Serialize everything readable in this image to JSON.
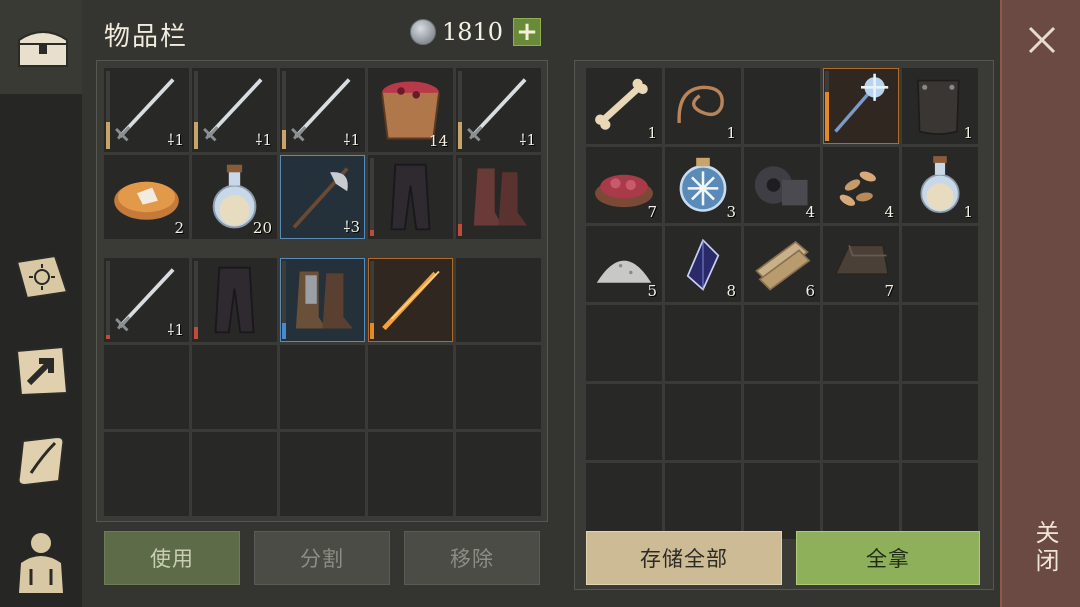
{
  "title": "物品栏",
  "currency": {
    "amount": "1810",
    "plus_label": "+"
  },
  "sidebar": {
    "tabs": [
      {
        "name": "inventory-chest-icon"
      },
      {
        "name": "skills-book-icon"
      },
      {
        "name": "map-arrow-icon"
      },
      {
        "name": "quest-scroll-icon"
      },
      {
        "name": "character-icon"
      }
    ]
  },
  "player_grid": {
    "rows": [
      [
        {
          "item": "sword",
          "count": "⸸1",
          "dur": 0.35,
          "durcolor": "tan"
        },
        {
          "item": "sword",
          "count": "⸸1",
          "dur": 0.35,
          "durcolor": "tan"
        },
        {
          "item": "sword",
          "count": "⸸1",
          "dur": 0.25,
          "durcolor": "tan"
        },
        {
          "item": "berry-bucket",
          "count": "14"
        },
        {
          "item": "sword",
          "count": "⸸1",
          "dur": 0.35,
          "durcolor": "tan"
        }
      ],
      [
        {
          "item": "pie",
          "count": "2"
        },
        {
          "item": "potion",
          "count": "20"
        },
        {
          "item": "halberd",
          "count": "⸸3",
          "sel": "blue"
        },
        {
          "item": "pants",
          "count": "",
          "dur": 0.08,
          "durcolor": "red"
        },
        {
          "item": "boots",
          "count": "",
          "dur": 0.15,
          "durcolor": "red"
        }
      ]
    ],
    "equip_row": [
      {
        "item": "sword",
        "count": "⸸1",
        "dur": 0.05,
        "durcolor": "red"
      },
      {
        "item": "pants",
        "count": "",
        "dur": 0.15,
        "durcolor": "red"
      },
      {
        "item": "boots-armored",
        "count": "",
        "sel": "blue",
        "dur": 0.2,
        "durcolor": "blue"
      },
      {
        "item": "flame-sword",
        "count": "",
        "sel": "orange",
        "dur": 0.2,
        "durcolor": "orange"
      },
      {
        "item": "",
        "count": ""
      }
    ],
    "empty_rows": 2
  },
  "storage_grid": {
    "items": [
      {
        "item": "bone",
        "count": "1"
      },
      {
        "item": "rope",
        "count": "1"
      },
      {
        "item": "",
        "count": ""
      },
      {
        "item": "ice-mace",
        "count": "",
        "sel": "orange",
        "dur": 0.7,
        "durcolor": "orange"
      },
      {
        "item": "shield-plate",
        "count": "1"
      },
      {
        "item": "meat-bowl",
        "count": "7"
      },
      {
        "item": "frost-orb",
        "count": "3"
      },
      {
        "item": "gears",
        "count": "4"
      },
      {
        "item": "seeds",
        "count": "4"
      },
      {
        "item": "potion",
        "count": "1"
      },
      {
        "item": "powder",
        "count": "5"
      },
      {
        "item": "crystal",
        "count": "8"
      },
      {
        "item": "planks",
        "count": "6"
      },
      {
        "item": "ingot",
        "count": "7"
      },
      {
        "item": "",
        "count": ""
      }
    ],
    "total_slots": 30
  },
  "buttons": {
    "use": "使用",
    "split": "分割",
    "remove": "移除",
    "store_all": "存储全部",
    "take_all": "全拿"
  },
  "close": {
    "label": "关闭"
  }
}
